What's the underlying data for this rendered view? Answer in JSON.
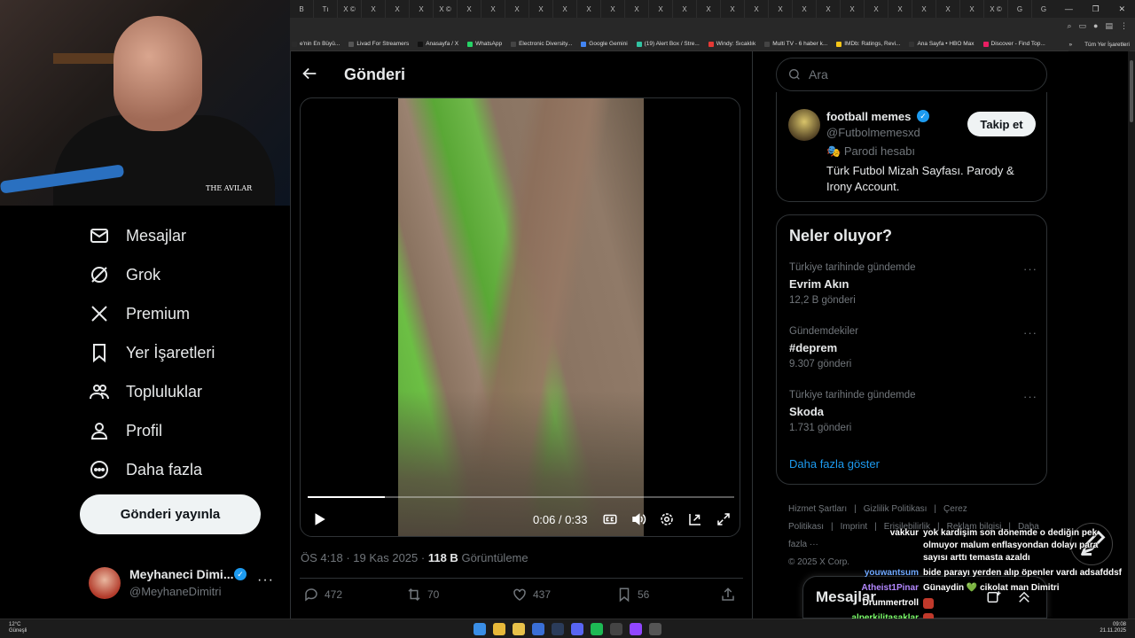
{
  "browser": {
    "tabs": [
      "B",
      "Tı",
      "X ©",
      "X",
      "X",
      "X",
      "X ©",
      "X",
      "X",
      "X",
      "X",
      "X",
      "X",
      "X",
      "X",
      "X",
      "X",
      "X",
      "X",
      "X",
      "X",
      "X",
      "X",
      "X",
      "X",
      "X",
      "X",
      "X",
      "X",
      "X ©",
      "G",
      "G"
    ],
    "new_tab": "+",
    "bookmarks": [
      "e'nin En Büyü...",
      "Livad For Streamers",
      "Anasayfa / X",
      "WhatsApp",
      "Electronic Diversity...",
      "Google Gemini",
      "(19) Alert Box / Stre...",
      "Windy: Sıcaklık",
      "Multi TV - 6 haber k...",
      "IMDb: Ratings, Revi...",
      "Ana Sayfa • HBO Max",
      "Discover - Find Top..."
    ],
    "bookmarks_more": "»",
    "bookmarks_folder": "Tüm Yer İşaretleri"
  },
  "nav": {
    "items": [
      {
        "label": "Mesajlar",
        "icon": "mail-icon"
      },
      {
        "label": "Grok",
        "icon": "grok-icon"
      },
      {
        "label": "Premium",
        "icon": "x-logo-icon"
      },
      {
        "label": "Yer İşaretleri",
        "icon": "bookmark-icon"
      },
      {
        "label": "Topluluklar",
        "icon": "communities-icon"
      },
      {
        "label": "Profil",
        "icon": "person-icon"
      },
      {
        "label": "Daha fazla",
        "icon": "more-circle-icon"
      }
    ],
    "post_button": "Gönderi yayınla",
    "profile": {
      "name": "Meyhaneci Dimi...",
      "handle": "@MeyhaneDimitri"
    }
  },
  "post": {
    "page_title": "Gönderi",
    "video": {
      "time": "0:06 / 0:33",
      "progress": 0.18
    },
    "meta": {
      "time": "ÖS 4:18",
      "sep": " · ",
      "date": "19 Kas 2025",
      "views": "118 B",
      "views_label": "Görüntüleme"
    },
    "actions": {
      "replies": "472",
      "reposts": "70",
      "likes": "437",
      "bookmarks": "56"
    }
  },
  "search": {
    "placeholder": "Ara"
  },
  "profile_card": {
    "name": "football memes",
    "handle": "@Futbolmemesxd",
    "parody": "Parodi hesabı",
    "bio": "Türk Futbol Mizah Sayfası. Parody & Irony Account.",
    "follow": "Takip et"
  },
  "trends": {
    "title": "Neler oluyor?",
    "items": [
      {
        "context": "Türkiye tarihinde gündemde",
        "name": "Evrim Akın",
        "count": "12,2 B gönderi"
      },
      {
        "context": "Gündemdekiler",
        "name": "#deprem",
        "count": "9.307 gönderi"
      },
      {
        "context": "Türkiye tarihinde gündemde",
        "name": "Skoda",
        "count": "1.731 gönderi"
      }
    ],
    "show_more": "Daha fazla göster"
  },
  "footer": {
    "links": [
      "Hizmet Şartları",
      "|",
      "Gizlilik Politikası",
      "|",
      "Çerez Politikası",
      "|",
      "Imprint",
      "|",
      "Erişilebilirlik",
      "|",
      "Reklam bilgisi",
      "|",
      "Daha fazla ···"
    ],
    "copyright": "© 2025 X Corp."
  },
  "chat": [
    {
      "user": "vakkur",
      "color": "#ffffff",
      "lines": [
        "yok kardişim son dönemde o dediğin pek",
        "olmuyor malum enflasyondan dolayı para",
        "sayısı arttı temasta azaldı"
      ]
    },
    {
      "user": "youwantsum",
      "color": "#6fa8ff",
      "lines": [
        "bide parayı yerden alıp öpenler vardı adsafddsf"
      ]
    },
    {
      "user": "Atheist1Pinar",
      "color": "#b388ff",
      "lines": [
        "Günaydin 💚 cikolat man Dimitri"
      ]
    },
    {
      "user": "Drummertroll",
      "color": "#ffffff",
      "lines": [
        ""
      ]
    },
    {
      "user": "alperkilitasaklar",
      "color": "#7cff6b",
      "lines": [
        ""
      ]
    }
  ],
  "messages_drawer": {
    "title": "Mesajlar"
  },
  "taskbar": {
    "weather_temp": "12°C",
    "weather_desc": "Güneşli",
    "time": "09:08",
    "date": "21.11.2025"
  },
  "webcam": {
    "logo": "THE AVILAR"
  },
  "colors": {
    "accent": "#1d9bf0",
    "bg": "#000000",
    "border": "#2f3336",
    "muted": "#71767b",
    "text": "#e7e9ea"
  }
}
